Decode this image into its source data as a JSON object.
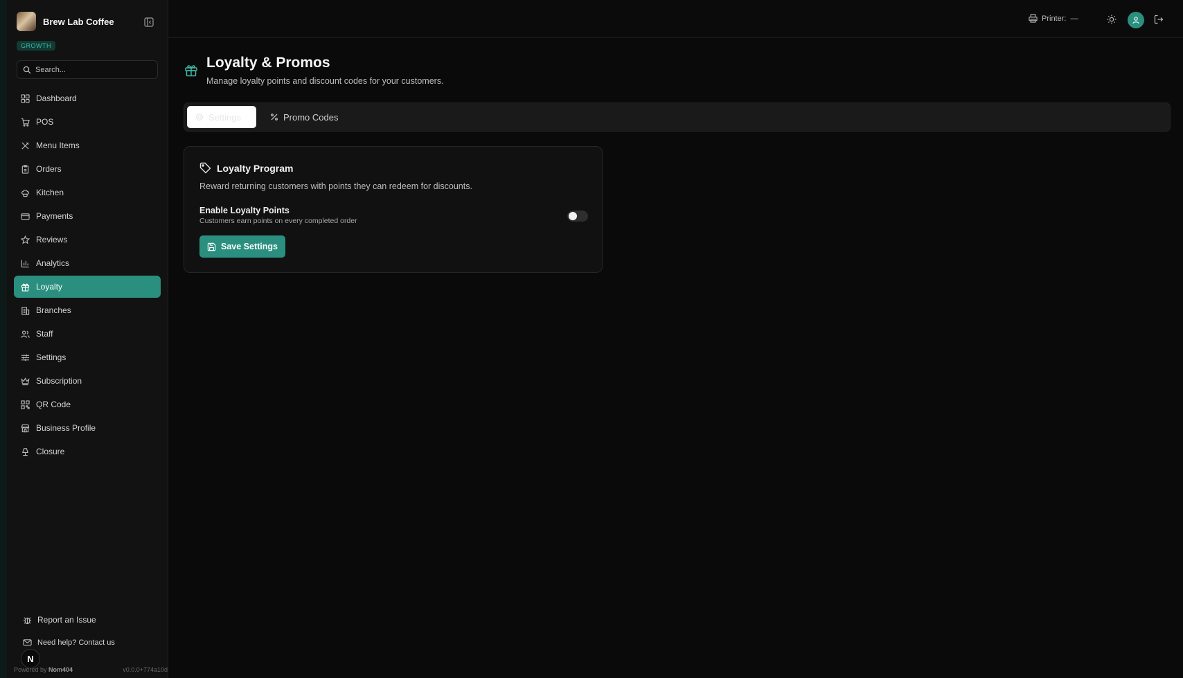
{
  "colors": {
    "accent": "#2a8f7e",
    "background": "#0a0a0a",
    "sidebar": "#121212"
  },
  "brand": {
    "name": "Brew Lab Coffee",
    "plan": "GROWTH"
  },
  "search": {
    "placeholder": "Search..."
  },
  "sidebar": {
    "items": [
      {
        "label": "Dashboard",
        "icon": "dashboard-icon"
      },
      {
        "label": "POS",
        "icon": "cart-icon"
      },
      {
        "label": "Menu Items",
        "icon": "utensils-icon"
      },
      {
        "label": "Orders",
        "icon": "clipboard-icon"
      },
      {
        "label": "Kitchen",
        "icon": "chef-hat-icon"
      },
      {
        "label": "Payments",
        "icon": "credit-card-icon"
      },
      {
        "label": "Reviews",
        "icon": "star-icon"
      },
      {
        "label": "Analytics",
        "icon": "bar-chart-icon"
      },
      {
        "label": "Loyalty",
        "icon": "gift-icon",
        "active": true
      },
      {
        "label": "Branches",
        "icon": "building-icon"
      },
      {
        "label": "Staff",
        "icon": "users-icon"
      },
      {
        "label": "Settings",
        "icon": "sliders-icon"
      },
      {
        "label": "Subscription",
        "icon": "crown-icon"
      },
      {
        "label": "QR Code",
        "icon": "qr-code-icon"
      },
      {
        "label": "Business Profile",
        "icon": "store-icon"
      },
      {
        "label": "Closure",
        "icon": "lamp-icon"
      }
    ],
    "report_issue": "Report an Issue",
    "help": "Need help? Contact us",
    "n_badge": "N",
    "powered_by": "Powered by",
    "powered_brand": "Nom404",
    "version": "v0.0.0+774a10d"
  },
  "topbar": {
    "printer_label": "Printer:",
    "printer_value": "—"
  },
  "page": {
    "title": "Loyalty & Promos",
    "subtitle": "Manage loyalty points and discount codes for your customers."
  },
  "tabs": [
    {
      "label": "Settings",
      "active": true
    },
    {
      "label": "Promo Codes",
      "active": false
    }
  ],
  "card": {
    "title": "Loyalty Program",
    "description": "Reward returning customers with points they can redeem for discounts.",
    "setting_label": "Enable Loyalty Points",
    "setting_help": "Customers earn points on every completed order",
    "toggle_enabled": false,
    "save_label": "Save Settings"
  }
}
